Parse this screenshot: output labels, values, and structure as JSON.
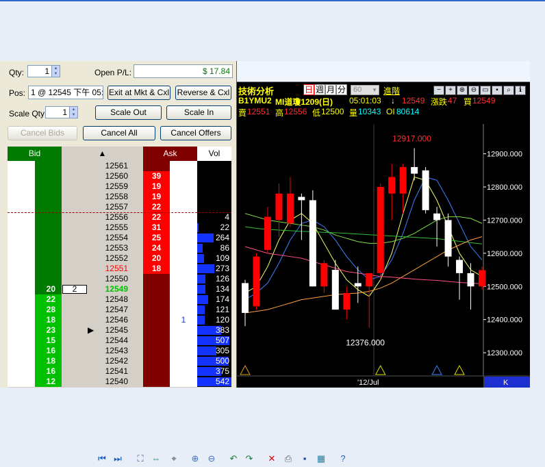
{
  "order_panel": {
    "qty_label": "Qty:",
    "qty_value": "1",
    "open_pl_label": "Open P/L:",
    "open_pl_value": "$ 17.84",
    "pos_label": "Pos:",
    "pos_value": "1 @ 12545 下午 05:4",
    "exit_button": "Exit at Mkt & Cxl",
    "reverse_button": "Reverse & Cxl",
    "scale_qty_label": "Scale Qty:",
    "scale_qty_value": "1",
    "scale_out_button": "Scale Out",
    "scale_in_button": "Scale In",
    "cancel_bids_button": "Cancel Bids",
    "cancel_all_button": "Cancel All",
    "cancel_offers_button": "Cancel Offers"
  },
  "ladder": {
    "headers": {
      "bid": "Bid",
      "price_arrow": "▲",
      "ask": "Ask",
      "vol": "Vol"
    },
    "rows": [
      {
        "price": "12561",
        "bid": "",
        "ask": "",
        "vol": "",
        "mine_bid": "",
        "mine_ask": ""
      },
      {
        "price": "12560",
        "bid": "",
        "ask": "39",
        "vol": "",
        "mine_bid": "",
        "mine_ask": ""
      },
      {
        "price": "12559",
        "bid": "",
        "ask": "19",
        "vol": "",
        "mine_bid": "",
        "mine_ask": ""
      },
      {
        "price": "12558",
        "bid": "",
        "ask": "19",
        "vol": "",
        "mine_bid": "",
        "mine_ask": ""
      },
      {
        "price": "12557",
        "bid": "",
        "ask": "22",
        "vol": "",
        "mine_bid": "",
        "mine_ask": ""
      },
      {
        "price": "12556",
        "bid": "",
        "ask": "22",
        "vol": "4",
        "mine_bid": "",
        "mine_ask": ""
      },
      {
        "price": "12555",
        "bid": "",
        "ask": "31",
        "vol": "22",
        "mine_bid": "",
        "mine_ask": ""
      },
      {
        "price": "12554",
        "bid": "",
        "ask": "25",
        "vol": "264",
        "mine_bid": "",
        "mine_ask": ""
      },
      {
        "price": "12553",
        "bid": "",
        "ask": "24",
        "vol": "86",
        "mine_bid": "",
        "mine_ask": ""
      },
      {
        "price": "12552",
        "bid": "",
        "ask": "20",
        "vol": "109",
        "mine_bid": "",
        "mine_ask": ""
      },
      {
        "price": "12551",
        "bid": "",
        "ask": "18",
        "vol": "273",
        "mine_bid": "",
        "mine_ask": ""
      },
      {
        "price": "12550",
        "bid": "",
        "ask": "",
        "vol": "126",
        "mine_bid": "",
        "mine_ask": ""
      },
      {
        "price": "12549",
        "bid": "20",
        "ask": "",
        "vol": "134",
        "mine_bid": "2",
        "mine_ask": ""
      },
      {
        "price": "12548",
        "bid": "22",
        "ask": "",
        "vol": "174",
        "mine_bid": "",
        "mine_ask": ""
      },
      {
        "price": "12547",
        "bid": "28",
        "ask": "",
        "vol": "121",
        "mine_bid": "",
        "mine_ask": ""
      },
      {
        "price": "12546",
        "bid": "18",
        "ask": "",
        "vol": "120",
        "mine_bid": "",
        "mine_ask": "1"
      },
      {
        "price": "12545",
        "bid": "23",
        "ask": "",
        "vol": "383",
        "mine_bid": "",
        "mine_ask": ""
      },
      {
        "price": "12544",
        "bid": "15",
        "ask": "",
        "vol": "507",
        "mine_bid": "",
        "mine_ask": ""
      },
      {
        "price": "12543",
        "bid": "16",
        "ask": "",
        "vol": "305",
        "mine_bid": "",
        "mine_ask": ""
      },
      {
        "price": "12542",
        "bid": "18",
        "ask": "",
        "vol": "500",
        "mine_bid": "",
        "mine_ask": ""
      },
      {
        "price": "12541",
        "bid": "16",
        "ask": "",
        "vol": "375",
        "mine_bid": "",
        "mine_ask": ""
      },
      {
        "price": "12540",
        "bid": "12",
        "ask": "",
        "vol": "542",
        "mine_bid": "",
        "mine_ask": ""
      }
    ],
    "last_price": "12549",
    "best_ask": "12551",
    "position_price": "12545",
    "position_marker": "▶",
    "colors": {
      "bid_dark": "#007a00",
      "bid_bright": "#00c000",
      "ask_dark": "#800000",
      "ask_bright": "#ff0000",
      "vol_bar": "#1433ff"
    }
  },
  "chart_header": {
    "title": "技術分析",
    "period_tabs": [
      "日",
      "週",
      "月",
      "分"
    ],
    "interval_value": "60",
    "advanced_label": "進階",
    "symbol": "B1YMU2",
    "name": "MI道瓊1209(日)",
    "time": "05:01:03",
    "arrow": "↓",
    "last": "12549",
    "change_label": "漲跌",
    "change_value": "47",
    "buy_label": "買",
    "buy_value": "12549",
    "sell_label": "賣",
    "sell_value": "12551",
    "high_label": "高",
    "high_value": "12556",
    "low_label": "低",
    "low_value": "12500",
    "volume_label": "量",
    "volume_value": "10343",
    "oi_label": "OI",
    "oi_value": "80614",
    "toolbar_icons": [
      "minus-icon",
      "plus-icon",
      "zoom-in-icon",
      "zoom-out-icon",
      "chat-icon",
      "save-icon",
      "search-icon",
      "info-icon"
    ]
  },
  "chart_data": {
    "type": "candlestick",
    "y_ticks": [
      "12900.000",
      "12800.000",
      "12700.000",
      "12600.000",
      "12500.000",
      "12400.000",
      "12300.000"
    ],
    "ylim": [
      12230,
      12990
    ],
    "high_annotation": "12917.000",
    "low_annotation": "12376.000",
    "x_label": "'12/Jul",
    "corner_label": "K",
    "candles": [
      {
        "o": 12510,
        "h": 12520,
        "l": 12380,
        "c": 12420
      },
      {
        "o": 12440,
        "h": 12600,
        "l": 12430,
        "c": 12590
      },
      {
        "o": 12610,
        "h": 12740,
        "l": 12600,
        "c": 12710
      },
      {
        "o": 12700,
        "h": 12810,
        "l": 12650,
        "c": 12780
      },
      {
        "o": 12690,
        "h": 12830,
        "l": 12680,
        "c": 12780
      },
      {
        "o": 12770,
        "h": 12780,
        "l": 12640,
        "c": 12760
      },
      {
        "o": 12760,
        "h": 12790,
        "l": 12500,
        "c": 12500
      },
      {
        "o": 12500,
        "h": 12580,
        "l": 12480,
        "c": 12570
      },
      {
        "o": 12550,
        "h": 12580,
        "l": 12430,
        "c": 12430
      },
      {
        "o": 12430,
        "h": 12500,
        "l": 12400,
        "c": 12480
      },
      {
        "o": 12510,
        "h": 12560,
        "l": 12450,
        "c": 12500
      },
      {
        "o": 12500,
        "h": 12540,
        "l": 12376,
        "c": 12540
      },
      {
        "o": 12540,
        "h": 12810,
        "l": 12520,
        "c": 12800
      },
      {
        "o": 12780,
        "h": 12870,
        "l": 12700,
        "c": 12830
      },
      {
        "o": 12780,
        "h": 12870,
        "l": 12720,
        "c": 12860
      },
      {
        "o": 12860,
        "h": 12917,
        "l": 12820,
        "c": 12840
      },
      {
        "o": 12850,
        "h": 12860,
        "l": 12720,
        "c": 12730
      },
      {
        "o": 12720,
        "h": 12740,
        "l": 12620,
        "c": 12700
      },
      {
        "o": 12700,
        "h": 12720,
        "l": 12560,
        "c": 12590
      },
      {
        "o": 12580,
        "h": 12590,
        "l": 12460,
        "c": 12540
      },
      {
        "o": 12540,
        "h": 12570,
        "l": 12430,
        "c": 12500
      },
      {
        "o": 12500,
        "h": 12560,
        "l": 12490,
        "c": 12549
      }
    ],
    "moving_averages": [
      {
        "color": "#ffff66",
        "values": [
          12480,
          12500,
          12560,
          12640,
          12700,
          12720,
          12690,
          12630,
          12570,
          12520,
          12490,
          12470,
          12520,
          12600,
          12720,
          12830,
          12820,
          12760,
          12680,
          12600,
          12550,
          12530
        ]
      },
      {
        "color": "#3f7fff",
        "values": [
          12460,
          12480,
          12510,
          12570,
          12640,
          12690,
          12700,
          12680,
          12640,
          12590,
          12550,
          12520,
          12530,
          12580,
          12660,
          12760,
          12830,
          12820,
          12760,
          12690,
          12620,
          12580
        ]
      },
      {
        "color": "#7fdf3f",
        "values": [
          12720,
          12710,
          12700,
          12695,
          12690,
          12685,
          12680,
          12670,
          12655,
          12645,
          12635,
          12630,
          12630,
          12635,
          12645,
          12660,
          12680,
          12700,
          12710,
          12710,
          12705,
          12690
        ]
      },
      {
        "color": "#30c030",
        "values": [
          12680,
          12675,
          12672,
          12670,
          12668,
          12666,
          12665,
          12663,
          12662,
          12660,
          12658,
          12656,
          12654,
          12652,
          12650,
          12648,
          12646,
          12644,
          12640,
          12636,
          12632,
          12628
        ]
      },
      {
        "color": "#ff9f3f",
        "values": [
          12420,
          12425,
          12430,
          12440,
          12450,
          12460,
          12465,
          12470,
          12475,
          12478,
          12480,
          12485,
          12495,
          12510,
          12530,
          12550,
          12570,
          12590,
          12610,
          12625,
          12640,
          12650
        ]
      },
      {
        "color": "#ff4f7f",
        "values": [
          12620,
          12610,
          12600,
          12595,
          12590,
          12585,
          12575,
          12565,
          12555,
          12545,
          12540,
          12535,
          12530,
          12528,
          12525,
          12522,
          12520,
          12518,
          12515,
          12512,
          12510,
          12508
        ]
      }
    ],
    "triangle_markers": [
      {
        "index": 0,
        "color": "#d9a020"
      },
      {
        "index": 12,
        "color": "#e0e000"
      },
      {
        "index": 17,
        "color": "#3f7fff"
      },
      {
        "index": 19,
        "color": "#e0e000"
      }
    ],
    "colors": {
      "up": "#ff0000",
      "down": "#ffffff",
      "background": "#000000",
      "axis_text": "#ffffff",
      "annotation": "#ff3030"
    }
  },
  "bottom_toolbar": {
    "icons": [
      "nav-first-icon",
      "nav-next-icon",
      "fit-page-icon",
      "fit-width-icon",
      "cursor-icon",
      "zoom-in-icon",
      "zoom-out-icon",
      "rotate-left-icon",
      "rotate-right-icon",
      "close-icon",
      "print-icon",
      "save-icon",
      "export-icon",
      "help-icon"
    ]
  }
}
